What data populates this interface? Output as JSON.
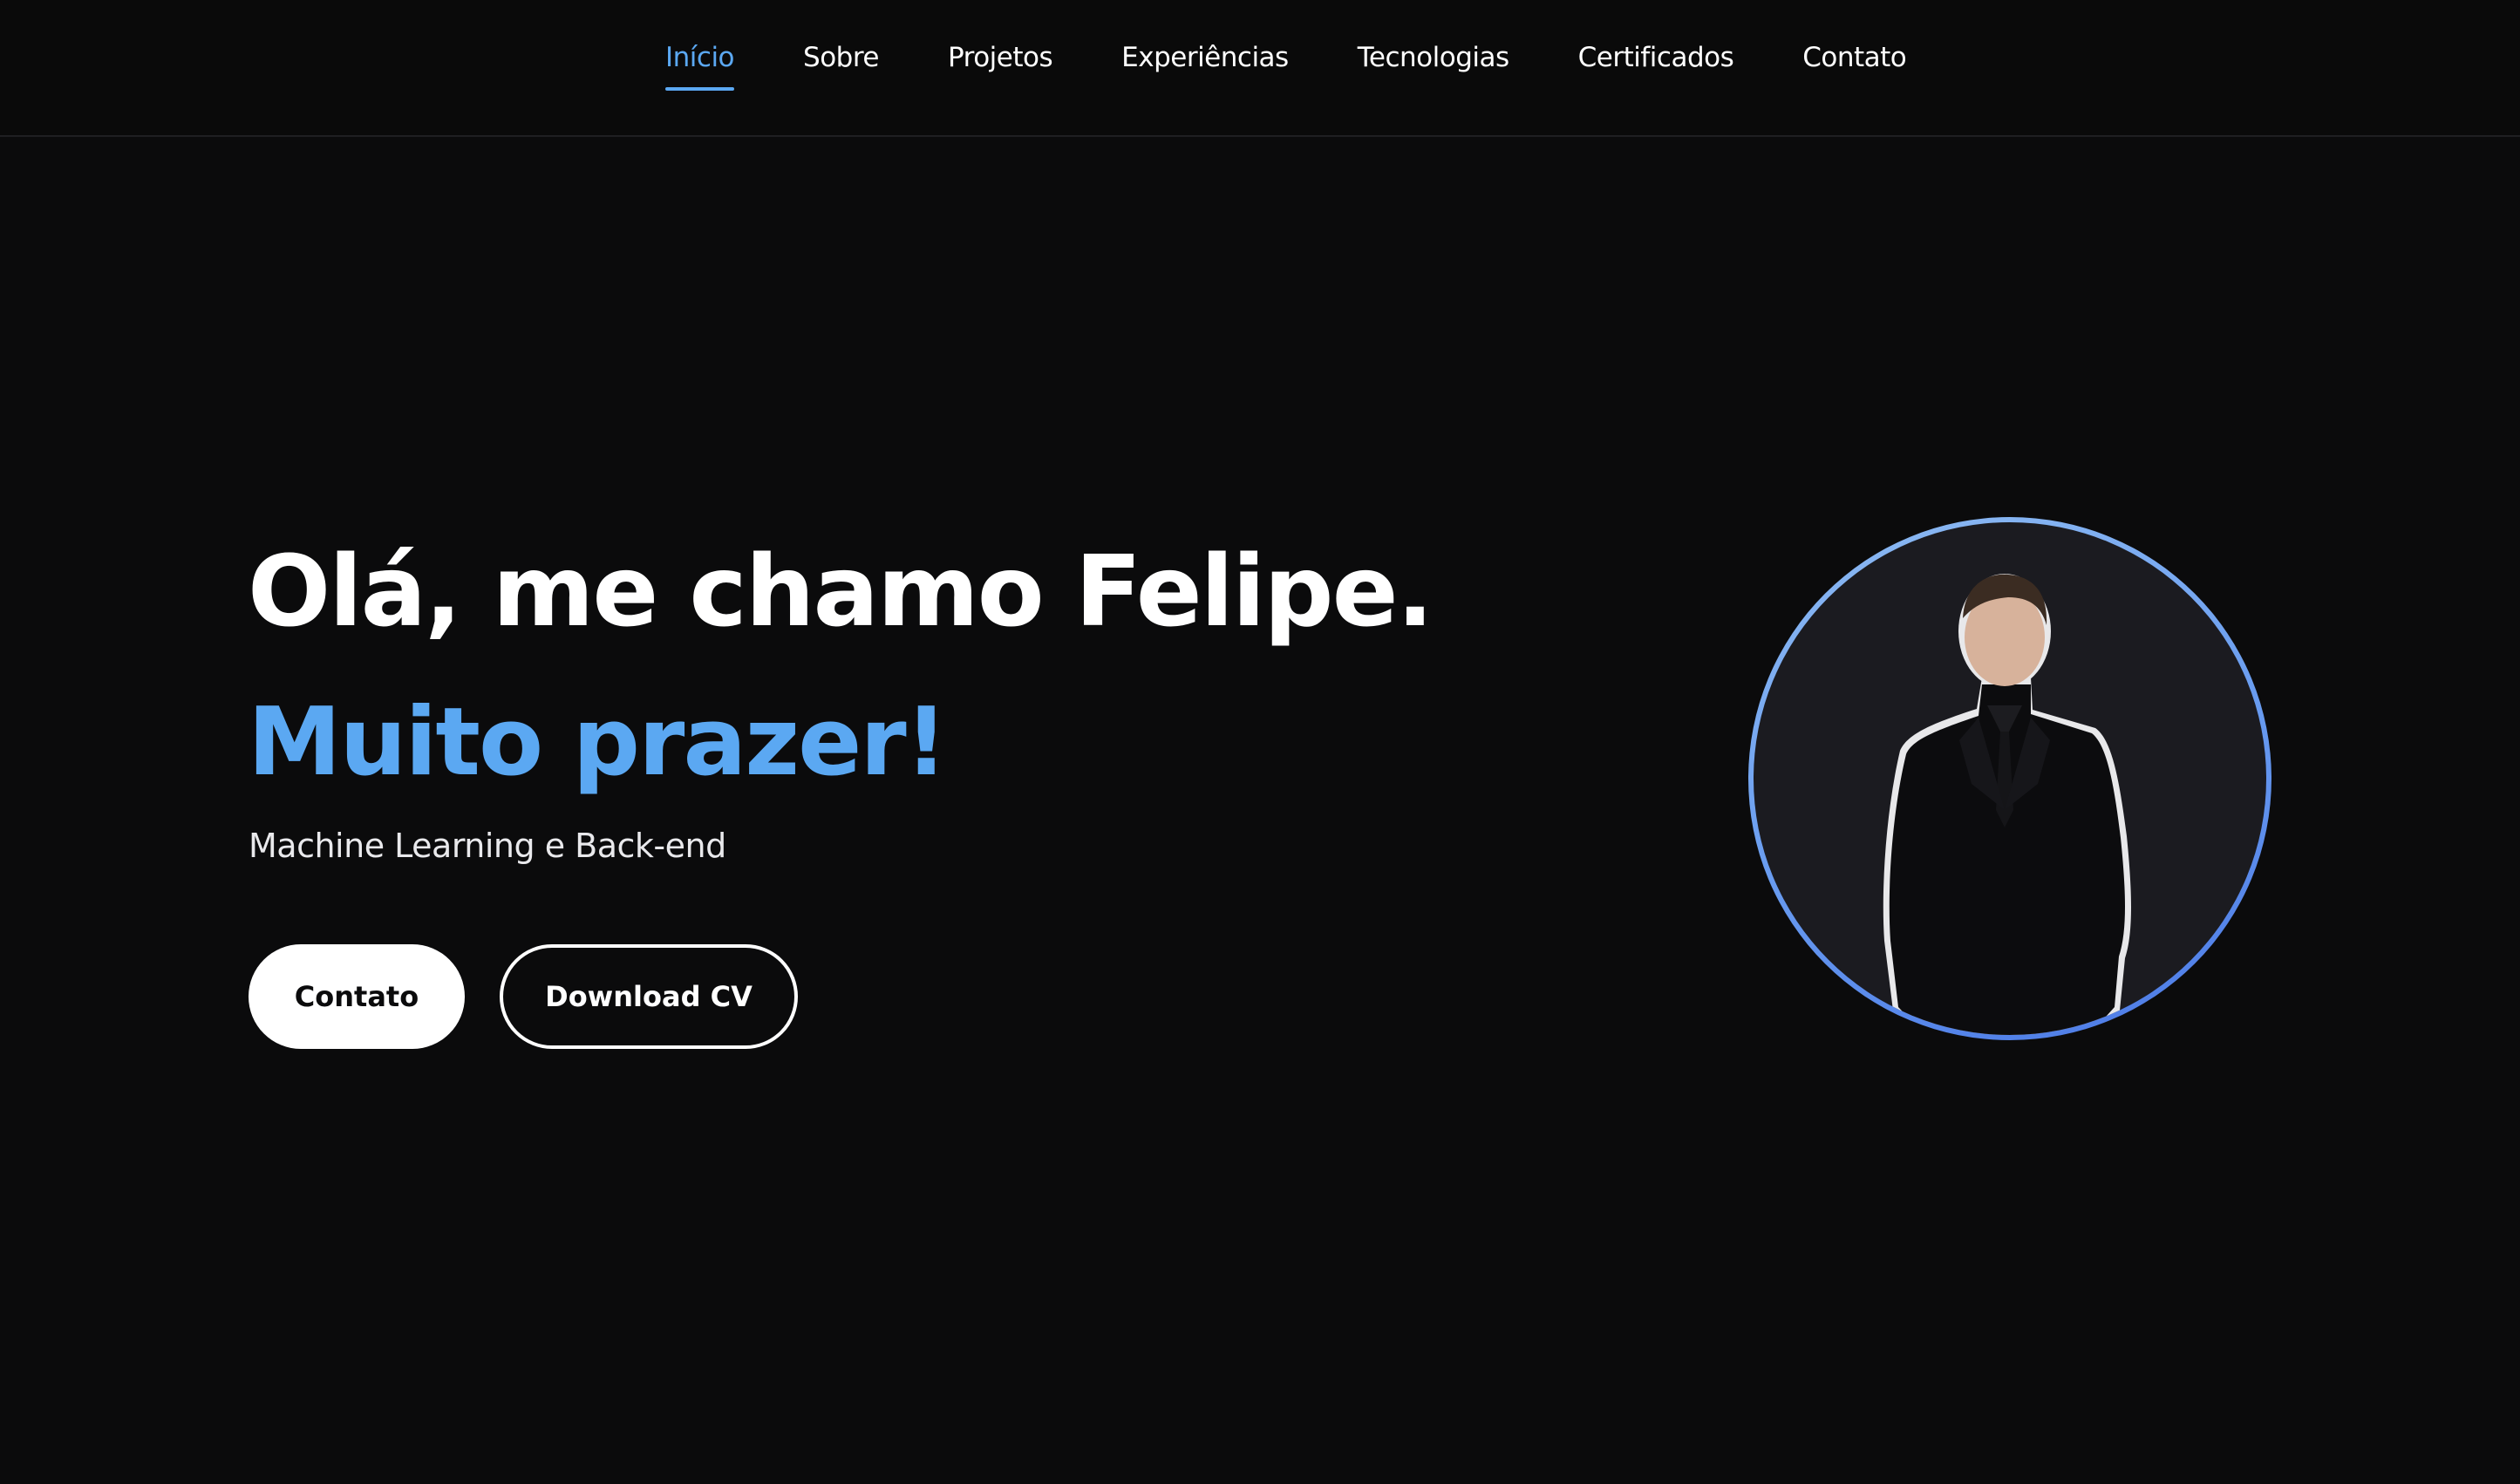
{
  "nav": {
    "items": [
      {
        "label": "Início",
        "active": true
      },
      {
        "label": "Sobre",
        "active": false
      },
      {
        "label": "Projetos",
        "active": false
      },
      {
        "label": "Experiências",
        "active": false
      },
      {
        "label": "Tecnologias",
        "active": false
      },
      {
        "label": "Certificados",
        "active": false
      },
      {
        "label": "Contato",
        "active": false
      }
    ]
  },
  "hero": {
    "title": "Olá, me chamo Felipe.",
    "subtitle": "Muito prazer!",
    "role": "Machine Learning e Back-end",
    "contact_button": "Contato",
    "cv_button": "Download CV"
  },
  "colors": {
    "accent": "#5ba8f2",
    "background": "#0b0b0c",
    "text": "#ffffff"
  }
}
